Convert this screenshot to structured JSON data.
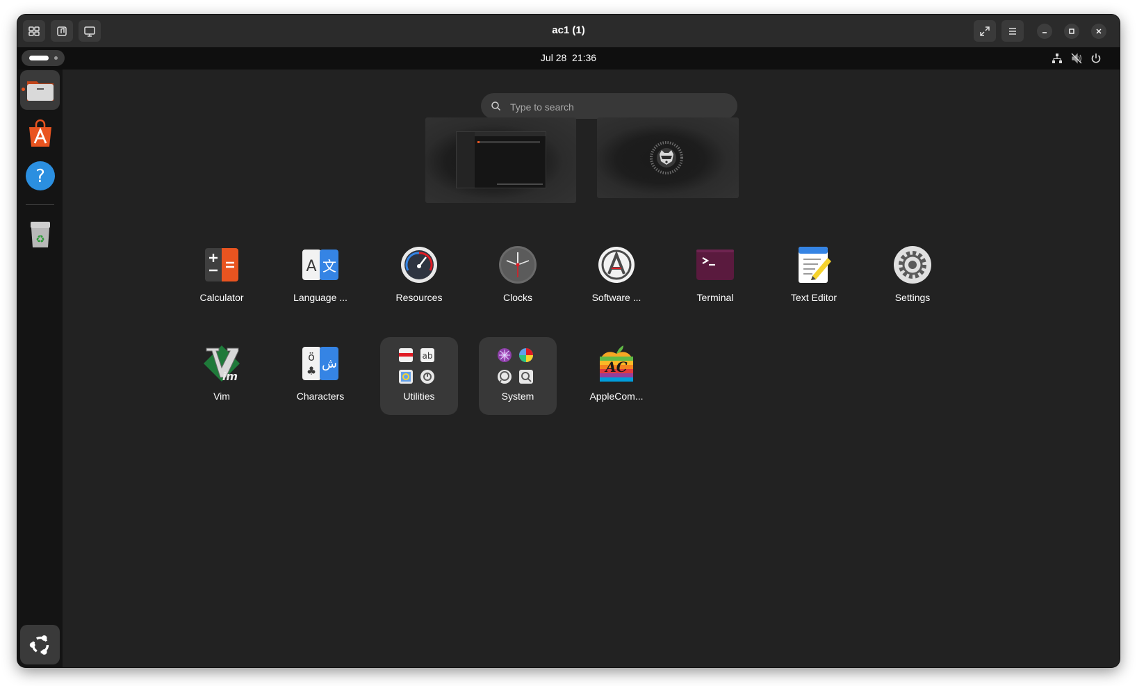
{
  "window": {
    "title": "ac1 (1)"
  },
  "topbar": {
    "clock": "Jul 28  21:36"
  },
  "search": {
    "placeholder": "Type to search",
    "value": ""
  },
  "dock": {
    "items": [
      {
        "name": "Files",
        "icon": "files-icon",
        "running": true
      },
      {
        "name": "App Center",
        "icon": "app-center-icon"
      },
      {
        "name": "Help",
        "icon": "help-icon"
      },
      {
        "name": "Trash",
        "icon": "trash-icon"
      }
    ],
    "show_apps_icon": "ubuntu-logo-icon"
  },
  "app_grid": {
    "rows": [
      [
        {
          "label": "Calculator",
          "icon": "calculator-icon"
        },
        {
          "label": "Language ...",
          "icon": "language-icon"
        },
        {
          "label": "Resources",
          "icon": "resources-icon"
        },
        {
          "label": "Clocks",
          "icon": "clocks-icon"
        },
        {
          "label": "Software ...",
          "icon": "software-icon"
        },
        {
          "label": "Terminal",
          "icon": "terminal-icon"
        },
        {
          "label": "Text Editor",
          "icon": "text-editor-icon"
        },
        {
          "label": "Settings",
          "icon": "settings-icon"
        }
      ],
      [
        {
          "label": "Vim",
          "icon": "vim-icon"
        },
        {
          "label": "Characters",
          "icon": "characters-icon"
        },
        {
          "label": "Utilities",
          "icon": "folder-icon",
          "folder": true
        },
        {
          "label": "System",
          "icon": "folder-icon",
          "folder": true
        },
        {
          "label": "AppleCom...",
          "icon": "applecom-icon"
        }
      ]
    ]
  },
  "colors": {
    "accent": "#e95420",
    "window_bg": "#222222",
    "topbar_bg": "#0f0f0f",
    "dock_bg": "#141414"
  }
}
